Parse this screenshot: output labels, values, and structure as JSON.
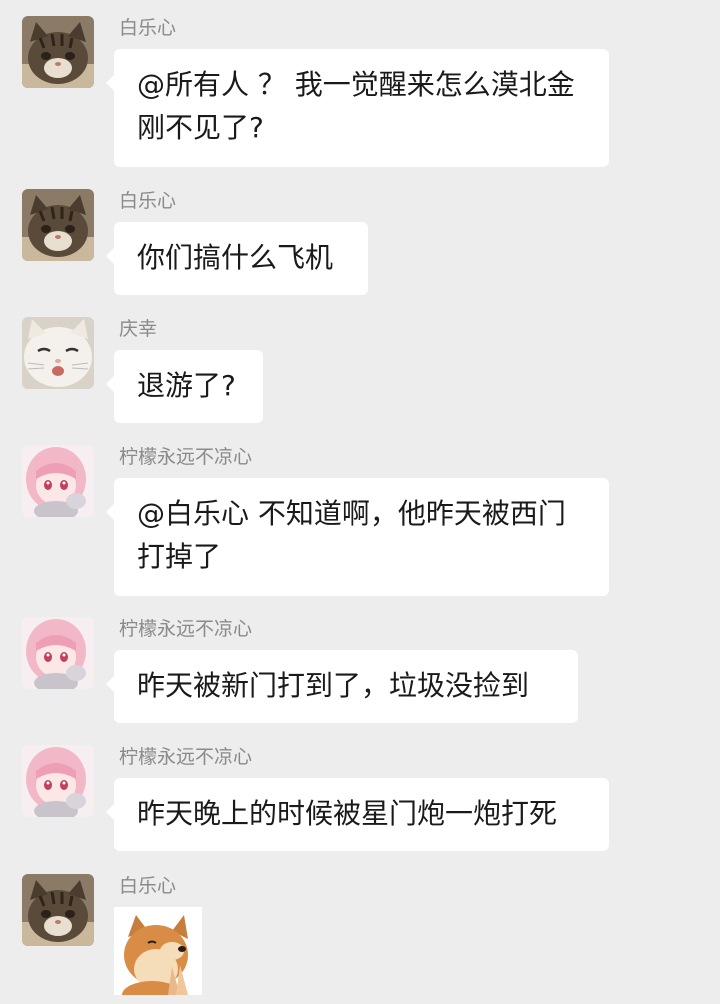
{
  "messages": [
    {
      "sender": "白乐心",
      "avatar_icon": "tabby-cat-avatar-icon",
      "text": "@所有人 ？ 我一觉醒来怎么漠北金\n刚不见了?"
    },
    {
      "sender": "白乐心",
      "avatar_icon": "tabby-cat-avatar-icon",
      "text": "你们搞什么飞机"
    },
    {
      "sender": "庆幸",
      "avatar_icon": "white-cat-avatar-icon",
      "text": "退游了?"
    },
    {
      "sender": "柠檬永远不凉心",
      "avatar_icon": "anime-girl-avatar-icon",
      "text": "@白乐心  不知道啊，他昨天被西门\n打掉了"
    },
    {
      "sender": "柠檬永远不凉心",
      "avatar_icon": "anime-girl-avatar-icon",
      "text": "昨天被新门打到了，垃圾没捡到"
    },
    {
      "sender": "柠檬永远不凉心",
      "avatar_icon": "anime-girl-avatar-icon",
      "text": "昨天晚上的时候被星门炮一炮打死"
    },
    {
      "sender": "白乐心",
      "avatar_icon": "tabby-cat-avatar-icon",
      "sticker_icon": "praying-doge-sticker-icon"
    }
  ]
}
